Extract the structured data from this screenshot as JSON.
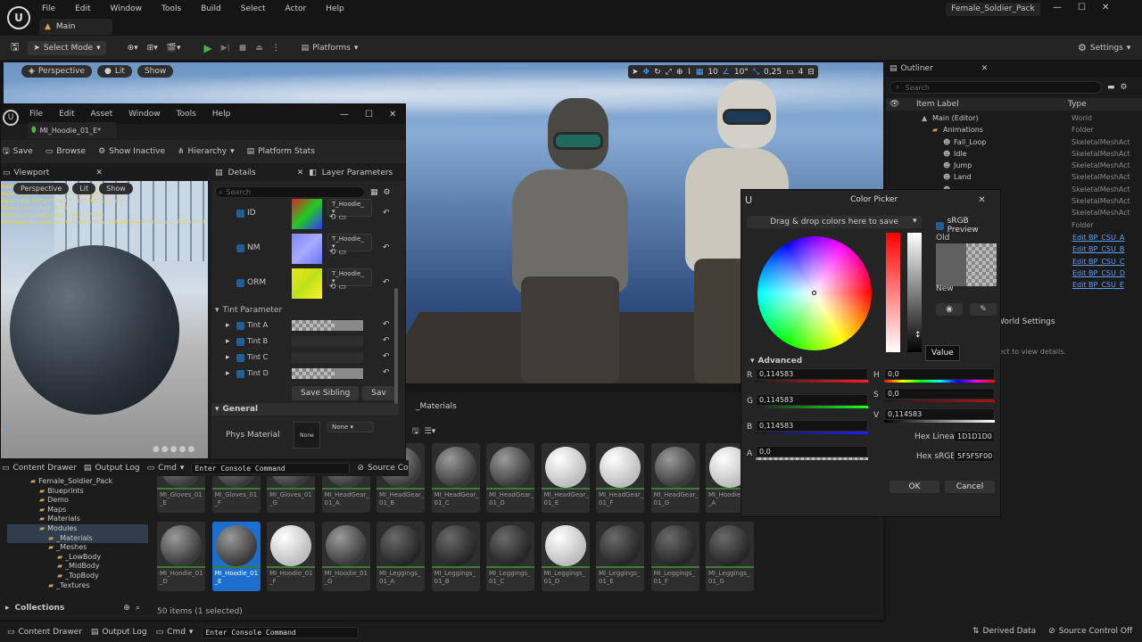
{
  "app": {
    "project": "Female_Soldier_Pack",
    "tab": "Main",
    "menu": [
      "File",
      "Edit",
      "Window",
      "Tools",
      "Build",
      "Select",
      "Actor",
      "Help"
    ]
  },
  "toolbar": {
    "select_mode": "Select Mode",
    "platforms": "Platforms",
    "settings": "Settings"
  },
  "viewport": {
    "perspective": "Perspective",
    "lit": "Lit",
    "show": "Show",
    "grid": "10",
    "angle": "10°",
    "scale": "0,25",
    "cams": "4"
  },
  "outliner": {
    "title": "Outliner",
    "search": "Search",
    "col_label": "Item Label",
    "col_type": "Type",
    "rows": [
      {
        "label": "Main (Editor)",
        "type": "World",
        "indent": 0
      },
      {
        "label": "Animations",
        "type": "Folder",
        "indent": 1
      },
      {
        "label": "Fall_Loop",
        "type": "SkeletalMeshAct",
        "indent": 2
      },
      {
        "label": "Idle",
        "type": "SkeletalMeshAct",
        "indent": 2
      },
      {
        "label": "Jump",
        "type": "SkeletalMeshAct",
        "indent": 2
      },
      {
        "label": "Land",
        "type": "SkeletalMeshAct",
        "indent": 2
      },
      {
        "label": "",
        "type": "SkeletalMeshAct",
        "indent": 2
      },
      {
        "label": "",
        "type": "SkeletalMeshAct",
        "indent": 2
      },
      {
        "label": "",
        "type": "SkeletalMeshAct",
        "indent": 2
      },
      {
        "label": "",
        "type": "Folder",
        "indent": 1
      }
    ],
    "links": [
      "Edit BP_CSU_A",
      "Edit BP_CSU_B",
      "Edit BP_CSU_C",
      "Edit BP_CSU_D",
      "Edit BP_CSU_E"
    ],
    "world_settings": "World Settings",
    "hint": "ject to view details."
  },
  "mat_editor": {
    "menu": [
      "File",
      "Edit",
      "Asset",
      "Window",
      "Tools",
      "Help"
    ],
    "tab": "MI_Hoodie_01_E*",
    "tools": {
      "save": "Save",
      "browse": "Browse",
      "show_inactive": "Show Inactive",
      "hierarchy": "Hierarchy",
      "platform_stats": "Platform Stats"
    },
    "viewport_tab": "Viewport",
    "perspective": "Perspective",
    "lit": "Lit",
    "show": "Show",
    "stats": [
      "Base pass shader: 165 instructions",
      "Base pass vertex shader: 112 instructions",
      "Base pass vertex shader: 173 instructions",
      "Texture samplers: 6/16",
      "Texture Lookups (Est.): VS(3), PS(4)",
      "Warning: 80 samples /Game/Female_Soldier_Pack/Modules/_Textures/T"
    ],
    "details_tab": "Details",
    "layer_tab": "Layer Parameters",
    "search": "Search",
    "textures": [
      {
        "label": "ID",
        "tex": "T_Hoodie_"
      },
      {
        "label": "NM",
        "tex": "T_Hoodie_"
      },
      {
        "label": "ORM",
        "tex": "T_Hoodie_"
      }
    ],
    "tint_group": "Tint Parameter",
    "tints": [
      "Tint A",
      "Tint B",
      "Tint C",
      "Tint D"
    ],
    "save_sibling": "Save Sibling",
    "save_child": "Sav",
    "general": "General",
    "phys_material": "Phys Material",
    "none": "None"
  },
  "content": {
    "path_tail": "_Materials",
    "count": "50 items (1 selected)",
    "collections": "Collections",
    "row1": [
      "MI_Gloves_01\n_E",
      "MI_Gloves_01\n_F",
      "MI_Gloves_01\n_G",
      "MI_HeadGear_\n01_A",
      "MI_HeadGear_\n01_B",
      "MI_HeadGear_\n01_C",
      "MI_HeadGear_\n01_D",
      "MI_HeadGear_\n01_E",
      "MI_HeadGear_\n01_F",
      "MI_HeadGear_\n01_G",
      "MI_Hoodie_\n_A"
    ],
    "row2": [
      "MI_Hoodie_01\n_D",
      "MI_Hoodie_01\n_E",
      "MI_Hoodie_01\n_F",
      "MI_Hoodie_01\n_G",
      "MI_Leggings_\n01_A",
      "MI_Leggings_\n01_B",
      "MI_Leggings_\n01_C",
      "MI_Leggings_\n01_D",
      "MI_Leggings_\n01_E",
      "MI_Leggings_\n01_F",
      "MI_Leggings_\n01_G"
    ],
    "tree": [
      {
        "label": "Female_Soldier_Pack",
        "indent": 0
      },
      {
        "label": "Blueprints",
        "indent": 1
      },
      {
        "label": "Demo",
        "indent": 1
      },
      {
        "label": "Maps",
        "indent": 1
      },
      {
        "label": "Materials",
        "indent": 1
      },
      {
        "label": "Modules",
        "indent": 1
      },
      {
        "label": "_Materials",
        "indent": 2
      },
      {
        "label": "_Meshes",
        "indent": 2
      },
      {
        "label": "_LowBody",
        "indent": 3
      },
      {
        "label": "_MidBody",
        "indent": 3
      },
      {
        "label": "_TopBody",
        "indent": 3
      },
      {
        "label": "_Textures",
        "indent": 2
      }
    ]
  },
  "bottom": {
    "content_drawer": "Content Drawer",
    "output_log": "Output Log",
    "cmd": "Cmd",
    "console": "Enter Console Command",
    "source_co": "Source Co",
    "derived": "Derived Data",
    "source_control": "Source Control Off"
  },
  "picker": {
    "title": "Color Picker",
    "drag": "Drag & drop colors here to save",
    "srgb": "sRGB Preview",
    "old": "Old",
    "new": "New",
    "advanced": "Advanced",
    "tooltip": "Value",
    "r": "0,114583",
    "g": "0,114583",
    "b": "0,114583",
    "a": "0,0",
    "h": "0,0",
    "s": "0,0",
    "v": "0,114583",
    "hex_linear_label": "Hex Linear",
    "hex_linear": "1D1D1D0",
    "hex_srgb_label": "Hex sRGB",
    "hex_srgb": "5F5F5F00",
    "ok": "OK",
    "cancel": "Cancel",
    "color": "#5F5F5F"
  }
}
